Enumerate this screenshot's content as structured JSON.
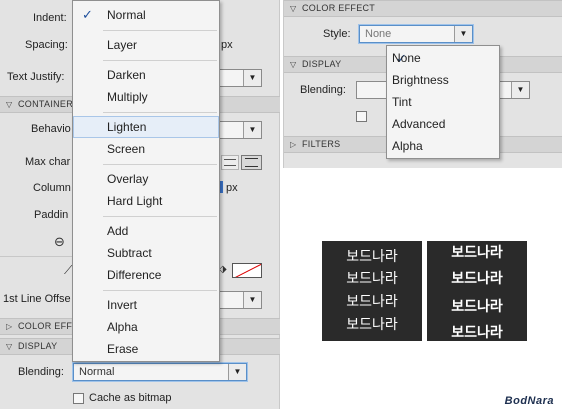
{
  "left_panel": {
    "indent_label": "Indent:",
    "spacing_label": "Spacing:",
    "spacing_unit": "px",
    "text_justify_label": "Text Justify:",
    "container_header": "CONTAINER",
    "behavior_label": "Behavio",
    "max_chars_label": "Max char",
    "columns_label": "Column",
    "columns_unit": "px",
    "padding_label": "Paddin",
    "first_line_offset_label": "1st Line Offse",
    "color_effect_header": "COLOR EFF",
    "display_header": "DISPLAY",
    "blending_label": "Blending:",
    "blending_value": "Normal",
    "cache_label": "Cache as bitmap"
  },
  "blend_menu": {
    "items": [
      "Normal",
      "Layer",
      "Darken",
      "Multiply",
      "Lighten",
      "Screen",
      "Overlay",
      "Hard Light",
      "Add",
      "Subtract",
      "Difference",
      "Invert",
      "Alpha",
      "Erase"
    ],
    "checked": "Normal",
    "hovered": "Lighten"
  },
  "right_panel": {
    "color_effect_header": "COLOR EFFECT",
    "style_label": "Style:",
    "style_value": "None",
    "display_header": "DISPLAY",
    "blending_label": "Blending:",
    "filters_header": "FILTERS"
  },
  "effect_menu": {
    "items": [
      "None",
      "Brightness",
      "Tint",
      "Advanced",
      "Alpha"
    ],
    "checked": "None"
  },
  "samples": {
    "regular": [
      "보드나라",
      "보드나라",
      "보드나라",
      "보드나라"
    ],
    "bold": [
      "보드나라",
      "보드나라",
      "보드나라",
      "보드나라"
    ]
  },
  "watermark": "BodNara",
  "colors": {
    "panel_bg": "#e3e3e3",
    "header_bg": "#d4d4d4",
    "menu_bg": "#f4f4f4",
    "hover_bg": "#e6eef8",
    "check_color": "#1e4f9c",
    "sample_bg": "#2a2a2a"
  }
}
